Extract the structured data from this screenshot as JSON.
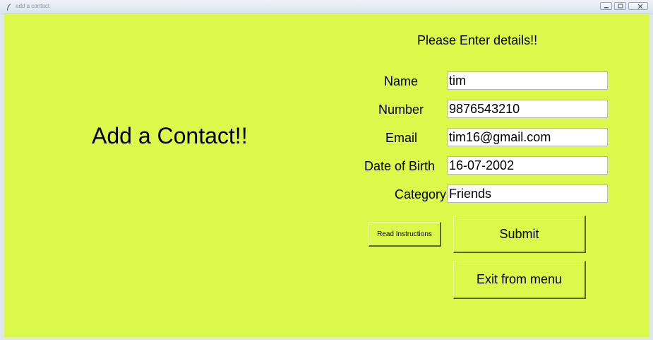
{
  "window": {
    "title": "add a contact",
    "icon": "feather-icon",
    "controls": [
      "minimize-icon",
      "maximize-icon",
      "close-icon"
    ]
  },
  "colors": {
    "background": "#dcf84b",
    "entry_background": "#ffffff",
    "text": "#000000"
  },
  "main": {
    "heading": "Add a Contact!!",
    "subheading": "Please Enter details!!"
  },
  "form": {
    "name": {
      "label": "Name",
      "value": "tim"
    },
    "number": {
      "label": "Number",
      "value": "9876543210"
    },
    "email": {
      "label": "Email",
      "value": "tim16@gmail.com"
    },
    "dob": {
      "label": "Date of Birth",
      "value": "16-07-2002"
    },
    "category": {
      "label": "Category",
      "value": "Friends"
    }
  },
  "buttons": {
    "read_instructions": "Read Instructions",
    "submit": "Submit",
    "exit": "Exit from menu"
  }
}
